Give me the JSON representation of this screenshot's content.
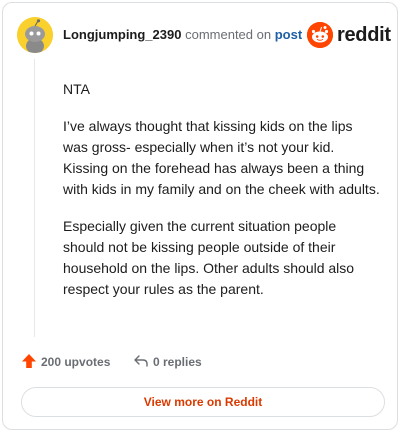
{
  "header": {
    "username": "Longjumping_2390",
    "commented_on": "commented on",
    "post_link": "post",
    "brand": "reddit",
    "avatar_icon": "snoo-avatar-icon",
    "logo_icon": "reddit-snoo-icon"
  },
  "comment": {
    "paragraphs": [
      "NTA",
      "I’ve always thought that kissing kids on the lips was gross- especially when it’s not your kid. Kissing on the forehead has always been a thing with kids in my family and on the cheek with adults.",
      "Especially given the current situation people should not be kissing people outside of their household on the lips. Other adults should also respect your rules as the parent."
    ]
  },
  "actions": {
    "upvotes": "200 upvotes",
    "replies": "0 replies",
    "upvote_icon": "upvote-arrow-icon",
    "reply_icon": "reply-arrow-icon"
  },
  "footer": {
    "view_more": "View more on Reddit"
  },
  "colors": {
    "accent": "#ff4500",
    "link": "#1f5fa6",
    "button_text": "#d93a00",
    "avatar_bg": "#fad02c"
  }
}
